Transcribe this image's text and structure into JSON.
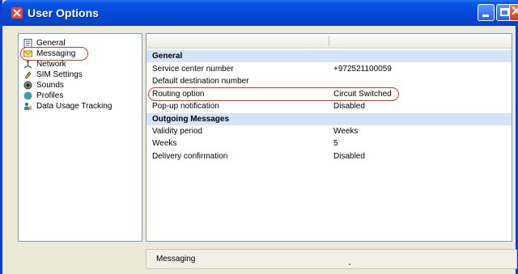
{
  "window": {
    "title": "User Options"
  },
  "nav": {
    "items": [
      {
        "label": "General",
        "icon": "document-icon"
      },
      {
        "label": "Messaging",
        "icon": "envelope-icon"
      },
      {
        "label": "Network",
        "icon": "network-icon"
      },
      {
        "label": "SIM Settings",
        "icon": "sim-icon"
      },
      {
        "label": "Sounds",
        "icon": "speaker-icon"
      },
      {
        "label": "Profiles",
        "icon": "globe-icon"
      },
      {
        "label": "Data Usage Tracking",
        "icon": "person-icon"
      }
    ],
    "selected": "Messaging"
  },
  "settings": {
    "general": {
      "header": "General",
      "rows": [
        {
          "key": "Service center number",
          "value": "+972521100059"
        },
        {
          "key": "Default destination number",
          "value": ""
        },
        {
          "key": "Routing option",
          "value": "Circuit Switched"
        },
        {
          "key": "Pop-up notification",
          "value": "Disabled"
        }
      ]
    },
    "outgoing": {
      "header": "Outgoing Messages",
      "rows": [
        {
          "key": "Validity period",
          "value": "Weeks"
        },
        {
          "key": "Weeks",
          "value": "5"
        },
        {
          "key": "Delivery confirmation",
          "value": "Disabled"
        }
      ]
    }
  },
  "status": {
    "text": "Messaging"
  },
  "colors": {
    "titlebar": "#0448d6",
    "section_bg": "#d5e3f7",
    "annotation": "#d23a2a"
  }
}
